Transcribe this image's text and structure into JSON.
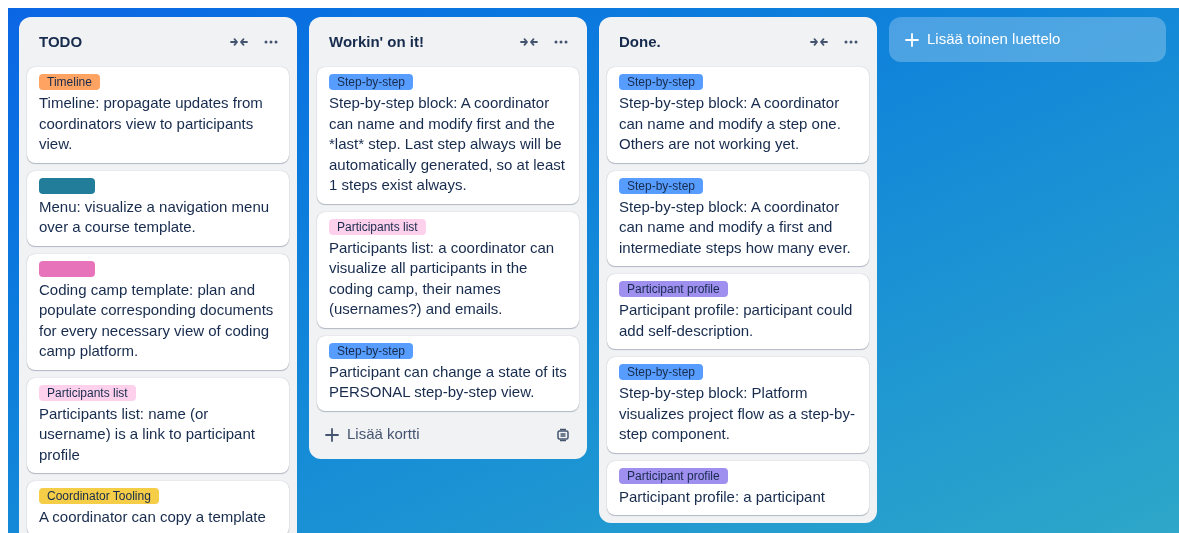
{
  "lists": [
    {
      "title": "TODO",
      "cards": [
        {
          "labels": [
            {
              "text": "Timeline",
              "color": "#fea362"
            }
          ],
          "text": "Timeline: propagate updates from coordinators view to participants view."
        },
        {
          "labels": [
            {
              "color": "#227d9b"
            }
          ],
          "text": "Menu: visualize a navigation menu over a course template."
        },
        {
          "labels": [
            {
              "color": "#e774bb"
            }
          ],
          "text": "Coding camp template: plan and populate corresponding documents for every necessary view of coding camp platform."
        },
        {
          "labels": [
            {
              "text": "Participants list",
              "color": "#fdd0ec"
            }
          ],
          "text": "Participants list: name (or username) is a link to participant profile"
        },
        {
          "labels": [
            {
              "text": "Coordinator Tooling",
              "color": "#f5cd47"
            }
          ],
          "text": "A coordinator can copy a template"
        }
      ]
    },
    {
      "title": "Workin' on it!",
      "cards": [
        {
          "labels": [
            {
              "text": "Step-by-step",
              "color": "#579dff"
            }
          ],
          "text": "Step-by-step block: A coordinator can name and modify first and the *last* step. Last step always will be automatically generated, so at least 1 steps exist always."
        },
        {
          "labels": [
            {
              "text": "Participants list",
              "color": "#fdd0ec"
            }
          ],
          "text": "Participants list: a coordinator can visualize all participants in the coding camp, their names (usernames?) and emails."
        },
        {
          "labels": [
            {
              "text": "Step-by-step",
              "color": "#579dff"
            }
          ],
          "text": "Participant can change a state of its PERSONAL step-by-step view."
        }
      ],
      "add_card": {
        "label": "Lisää kortti"
      }
    },
    {
      "title": "Done.",
      "cards": [
        {
          "labels": [
            {
              "text": "Step-by-step",
              "color": "#579dff"
            }
          ],
          "text": "Step-by-step block: A coordinator can name and modify a step one. Others are not working yet."
        },
        {
          "labels": [
            {
              "text": "Step-by-step",
              "color": "#579dff"
            }
          ],
          "text": "Step-by-step block: A coordinator can name and modify a first and intermediate steps how many ever."
        },
        {
          "labels": [
            {
              "text": "Participant profile",
              "color": "#9f8fef"
            }
          ],
          "text": "Participant profile: participant could add self-description."
        },
        {
          "labels": [
            {
              "text": "Step-by-step",
              "color": "#579dff"
            }
          ],
          "text": "Step-by-step block: Platform visualizes project flow as a step-by-step component."
        },
        {
          "labels": [
            {
              "text": "Participant profile",
              "color": "#9f8fef"
            }
          ],
          "text": "Participant profile: a participant"
        }
      ]
    }
  ],
  "add_list": {
    "label": "Lisää toinen luettelo"
  }
}
